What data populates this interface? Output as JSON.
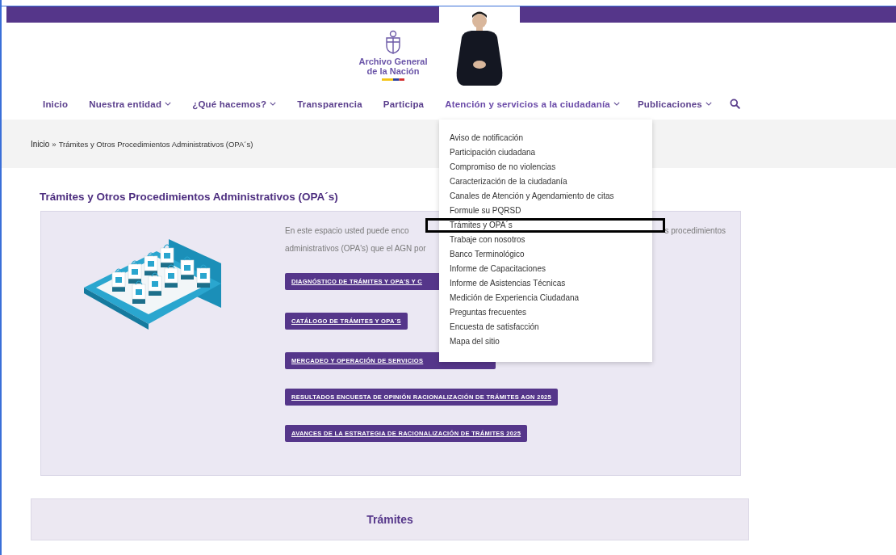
{
  "logo": {
    "line_1": "Archivo General",
    "line_2": "de la Nación"
  },
  "nav": [
    {
      "label": "Inicio",
      "has_menu": false,
      "expanded": false
    },
    {
      "label": "Nuestra entidad",
      "has_menu": true,
      "expanded": false
    },
    {
      "label": "¿Qué hacemos?",
      "has_menu": true,
      "expanded": false
    },
    {
      "label": "Transparencia",
      "has_menu": false,
      "expanded": false
    },
    {
      "label": "Participa",
      "has_menu": false,
      "expanded": false
    },
    {
      "label": "Atención y servicios a la ciudadanía",
      "has_menu": true,
      "expanded": true
    },
    {
      "label": "Publicaciones",
      "has_menu": true,
      "expanded": false
    }
  ],
  "dropdown": [
    {
      "label": "Aviso de notificación",
      "selected": false
    },
    {
      "label": "Participación ciudadana",
      "selected": false
    },
    {
      "label": "Compromiso de no violencias",
      "selected": false
    },
    {
      "label": "Caracterización de la ciudadanía",
      "selected": false
    },
    {
      "label": "Canales de Atención y Agendamiento de citas",
      "selected": false
    },
    {
      "label": "Formule su PQRSD",
      "selected": false
    },
    {
      "label": "Trámites y OPA´s",
      "selected": true
    },
    {
      "label": "Trabaje con nosotros",
      "selected": false
    },
    {
      "label": "Banco Terminológico",
      "selected": false
    },
    {
      "label": "Informe de Capacitaciones",
      "selected": false
    },
    {
      "label": "Informe de Asistencias Técnicas",
      "selected": false
    },
    {
      "label": "Medición de Experiencia Ciudadana",
      "selected": false
    },
    {
      "label": "Preguntas frecuentes",
      "selected": false
    },
    {
      "label": "Encuesta de satisfacción",
      "selected": false
    },
    {
      "label": "Mapa del sitio",
      "selected": false
    }
  ],
  "breadcrumb": {
    "home": "Inicio",
    "separator": "»",
    "current": "Trámites y Otros Procedimientos Administrativos (OPA´s)"
  },
  "heading": "Trámites y Otros Procedimientos Administrativos (OPA´s)",
  "intro": {
    "line_1_start": "En este espacio usted puede enco",
    "line_1_end": "s procedimientos",
    "line_2_start": "administrativos (OPA's) que el AGN por"
  },
  "buttons": [
    "DIAGNÓSTICO DE TRÁMITES Y OPA'S Y C",
    "CATÁLOGO DE TRÁMITES Y OPA´S",
    "MERCADEO Y OPERACIÓN DE SERVICIOS",
    "RESULTADOS ENCUESTA DE OPINIÓN RACIONALIZACIÓN DE TRÁMITES AGN 2025",
    "AVANCES DE LA ESTRATEGIA DE RACIONALIZACIÓN DE TRÁMITES 2025"
  ],
  "section": {
    "title": "Trámites"
  }
}
